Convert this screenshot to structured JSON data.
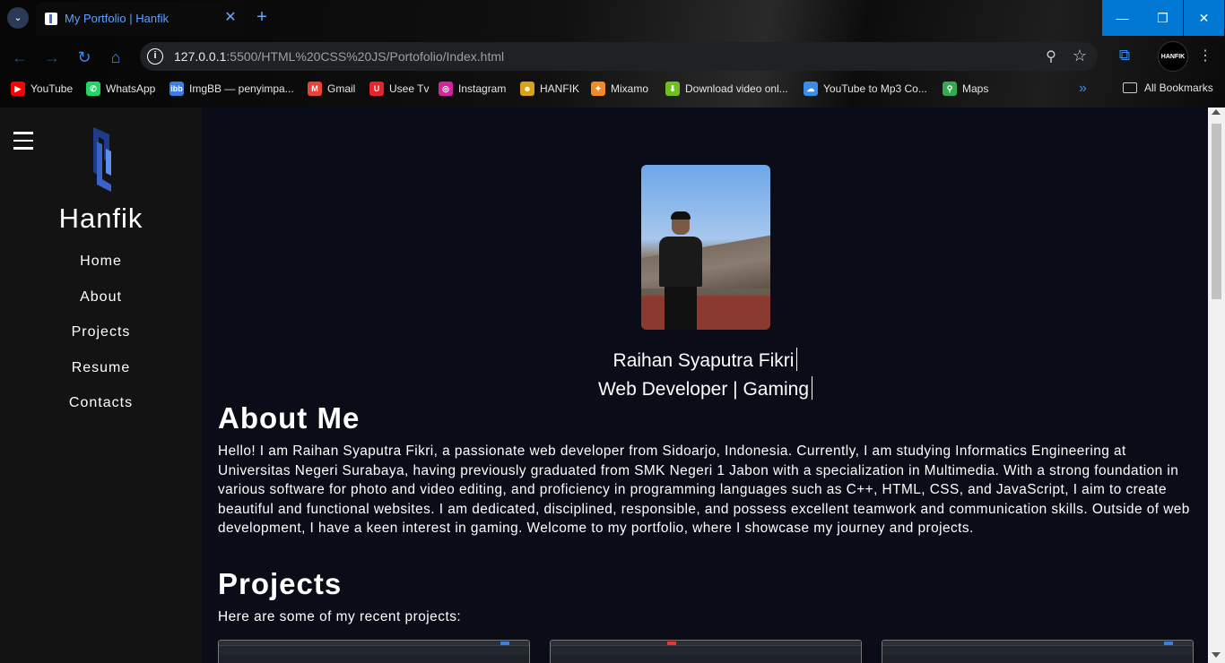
{
  "browser": {
    "tab_title": "My Portfolio | Hanfik",
    "tab_close": "✕",
    "new_tab": "+",
    "url_host": "127.0.0.1",
    "url_path": ":5500/HTML%20CSS%20JS/Portofolio/Index.html",
    "profile_label": "HANFIK",
    "window_controls": {
      "minimize": "—",
      "maximize": "❐",
      "close": "✕"
    },
    "nav_icons": {
      "back": "←",
      "forward": "→",
      "reload": "↻",
      "home": "⌂",
      "info": "i",
      "zoom": "⚲",
      "star": "☆",
      "extensions": "⧉",
      "menu": "⋮",
      "tab_search": "⌄",
      "more": "»"
    },
    "bookmarks": [
      {
        "label": "YouTube",
        "icon": "youtube-icon",
        "color": "#ff0000",
        "glyph": "▶"
      },
      {
        "label": "WhatsApp",
        "icon": "whatsapp-icon",
        "color": "#25d366",
        "glyph": "✆"
      },
      {
        "label": "ImgBB — penyimpa...",
        "icon": "imgbb-icon",
        "color": "#3d7de0",
        "glyph": "ibb"
      },
      {
        "label": "Gmail",
        "icon": "gmail-icon",
        "color": "#ea4335",
        "glyph": "M"
      },
      {
        "label": "Usee Tv",
        "icon": "useetv-icon",
        "color": "#e3262e",
        "glyph": "U"
      },
      {
        "label": "Instagram",
        "icon": "instagram-icon",
        "color": "#d6249f",
        "glyph": "◎"
      },
      {
        "label": "HANFIK",
        "icon": "hanfik-icon",
        "color": "#d9a21b",
        "glyph": "☻"
      },
      {
        "label": "Mixamo",
        "icon": "mixamo-icon",
        "color": "#f08a24",
        "glyph": "✦"
      },
      {
        "label": "Download video onl...",
        "icon": "download-icon",
        "color": "#6fbf1f",
        "glyph": "⬇"
      },
      {
        "label": "YouTube to Mp3 Co...",
        "icon": "cloud-download-icon",
        "color": "#3d8be8",
        "glyph": "☁"
      },
      {
        "label": "Maps",
        "icon": "maps-icon",
        "color": "#34a853",
        "glyph": "⚲"
      }
    ],
    "all_bookmarks": "All Bookmarks"
  },
  "sidebar": {
    "brand": "Hanfik",
    "nav": [
      "Home",
      "About",
      "Projects",
      "Resume",
      "Contacts"
    ]
  },
  "hero": {
    "name": "Raihan Syaputra Fikri",
    "role": "Web Developer | Gaming"
  },
  "about": {
    "heading": "About Me",
    "text": "Hello! I am Raihan Syaputra Fikri, a passionate web developer from Sidoarjo, Indonesia. Currently, I am studying Informatics Engineering at Universitas Negeri Surabaya, having previously graduated from SMK Negeri 1 Jabon with a specialization in Multimedia. With a strong foundation in various software for photo and video editing, and proficiency in programming languages such as C++, HTML, CSS, and JavaScript, I aim to create beautiful and functional websites. I am dedicated, disciplined, responsible, and possess excellent teamwork and communication skills. Outside of web development, I have a keen interest in gaming. Welcome to my portfolio, where I showcase my journey and projects."
  },
  "projects": {
    "heading": "Projects",
    "intro": "Here are some of my recent projects:"
  },
  "colors": {
    "page_bg": "#0a0c17",
    "sidebar_bg": "#131313",
    "accent": "#3d8be8",
    "window_ctrl": "#0078d4"
  }
}
